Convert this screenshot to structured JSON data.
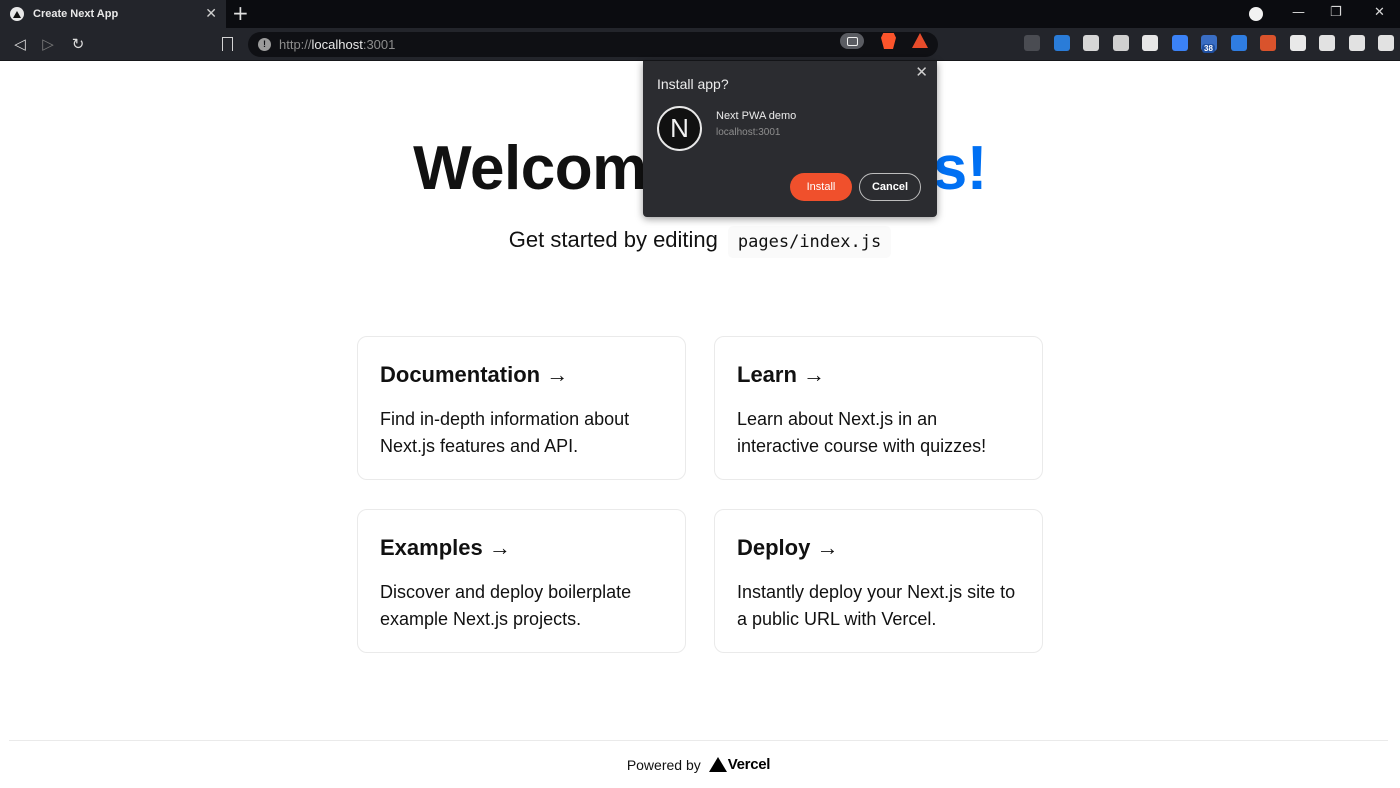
{
  "browser": {
    "tab": {
      "title": "Create Next App",
      "close_glyph": "✕"
    },
    "new_tab_glyph": "+",
    "window_controls": {
      "minimize": "—",
      "restore": "❐",
      "close": "✕"
    },
    "nav": {
      "back_glyph": "◁",
      "forward_glyph": "▷",
      "reload_glyph": "↻"
    },
    "address": {
      "scheme": "http://",
      "host": "localhost",
      "port": ":3001",
      "info_glyph": "!"
    }
  },
  "extensions": [
    {
      "name": "ext-dots-icon",
      "color": "#4a4c52"
    },
    {
      "name": "css3-icon",
      "color": "#2a7cd8"
    },
    {
      "name": "pen-icon",
      "color": "#d6d6d6"
    },
    {
      "name": "image-icon",
      "color": "#d0d0d0"
    },
    {
      "name": "target-icon",
      "color": "#e6e6e6"
    },
    {
      "name": "gear-blue-icon",
      "color": "#3b82f6"
    },
    {
      "name": "badge-icon",
      "color": "#3a6ec4",
      "badge": "38"
    },
    {
      "name": "grammarly-icon",
      "color": "#2f7de1"
    },
    {
      "name": "shield-red-icon",
      "color": "#d9532c"
    },
    {
      "name": "download-icon",
      "color": "#e9e9e9"
    },
    {
      "name": "puzzle-icon",
      "color": "#e2e2e2"
    },
    {
      "name": "playlist-icon",
      "color": "#e2e2e2"
    },
    {
      "name": "menu-icon",
      "color": "#e2e2e2"
    }
  ],
  "page": {
    "title_main": "Welcom",
    "title_accent": "s!",
    "subtitle": "Get started by editing",
    "code": "pages/index.js",
    "cards": [
      {
        "title": "Documentation →",
        "desc": "Find in-depth information about Next.js features and API."
      },
      {
        "title": "Learn →",
        "desc": "Learn about Next.js in an interactive course with quizzes!"
      },
      {
        "title": "Examples →",
        "desc": "Discover and deploy boilerplate example Next.js projects."
      },
      {
        "title": "Deploy →",
        "desc": "Instantly deploy your Next.js site to a public URL with Vercel."
      }
    ],
    "footer": {
      "powered_by": "Powered by",
      "brand": "Vercel"
    }
  },
  "install_popup": {
    "title": "Install app?",
    "close_glyph": "✕",
    "app_icon_letter": "N",
    "app_name": "Next PWA demo",
    "app_host": "localhost:3001",
    "install_label": "Install",
    "cancel_label": "Cancel"
  },
  "colors": {
    "accent_blue": "#0070f3",
    "install_orange": "#f0502c",
    "chrome_dark": "#23252b"
  }
}
